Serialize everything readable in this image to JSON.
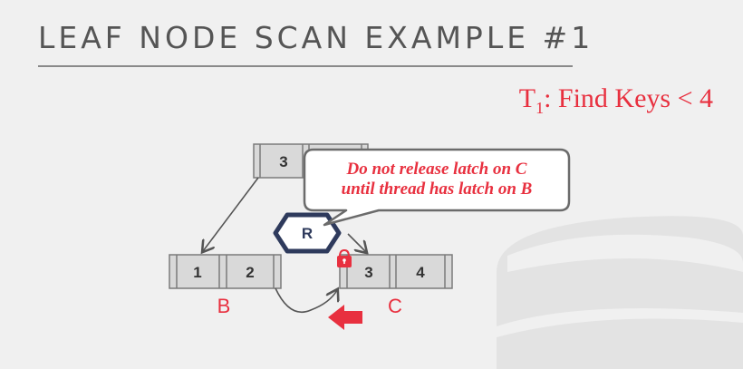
{
  "slide": {
    "title": "LEAF NODE SCAN EXAMPLE #1",
    "query_prefix": "T",
    "query_sub": "1",
    "query_rest": ": Find Keys < 4"
  },
  "tree": {
    "root_key": "3",
    "leaf_b_keys": [
      "1",
      "2"
    ],
    "leaf_c_keys": [
      "3",
      "4"
    ],
    "leaf_b_label": "B",
    "leaf_c_label": "C"
  },
  "latch": {
    "label": "R"
  },
  "callout": {
    "line1": "Do not release latch on C",
    "line2": "until thread has latch on B"
  },
  "colors": {
    "accent_red": "#e8303f",
    "latch_navy": "#2e3a5c",
    "node_fill": "#d9d9d9"
  }
}
